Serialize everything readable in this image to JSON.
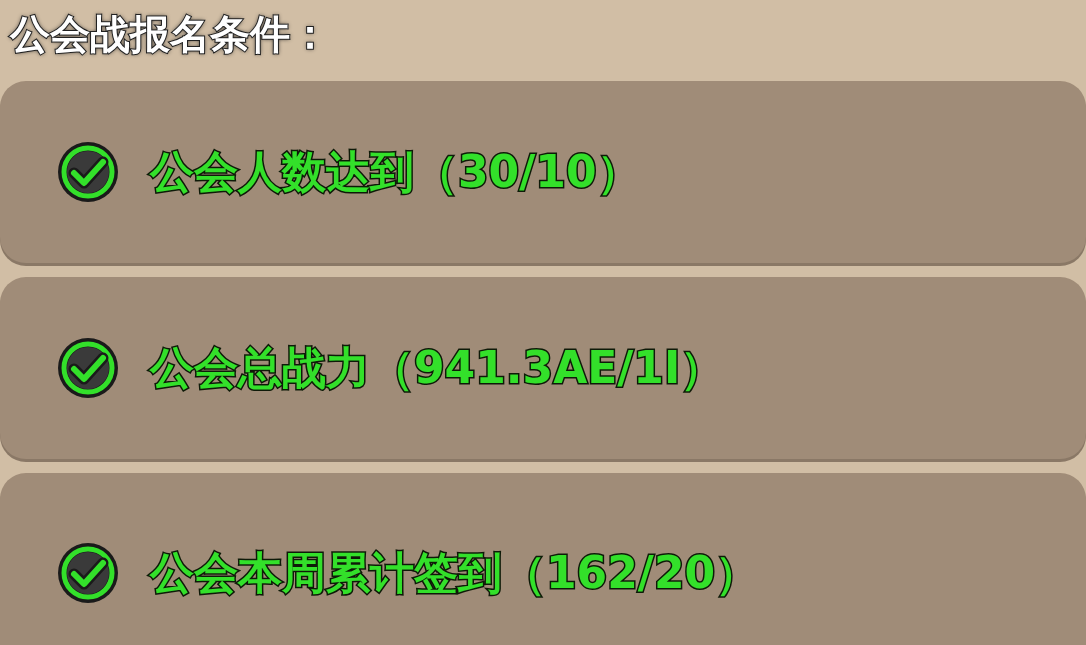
{
  "title": "公会战报名条件：",
  "conditions": [
    {
      "label": "公会人数达到（30/10）",
      "met": true
    },
    {
      "label": "公会总战力（941.3AE/1I）",
      "met": true
    },
    {
      "label": "公会本周累计签到（162/20）",
      "met": true
    }
  ]
}
